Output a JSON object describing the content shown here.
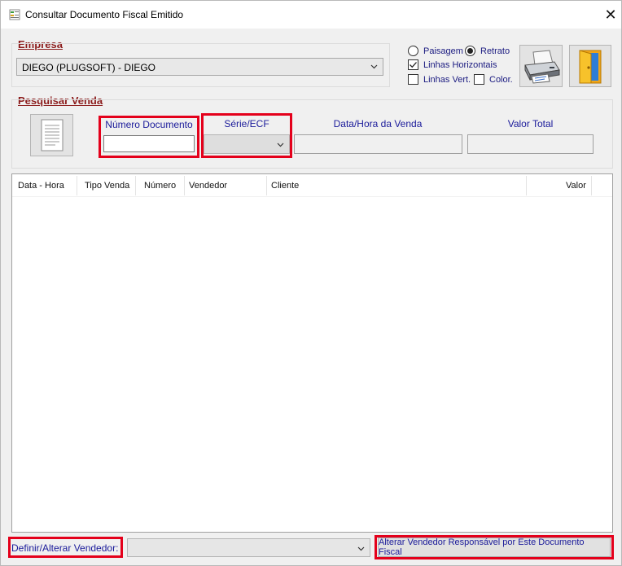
{
  "window": {
    "title": "Consultar Documento Fiscal Emitido",
    "close_glyph": "✕"
  },
  "empresa": {
    "section_title": "Empresa",
    "selected": "DIEGO  (PLUGSOFT) - DIEGO"
  },
  "print_options": {
    "paisagem": "Paisagem",
    "retrato": "Retrato",
    "linhas_horizontais": "Linhas Horizontais",
    "linhas_vert": "Linhas Vert.",
    "color": "Color.",
    "selected_orientation": "Retrato",
    "linhas_horizontais_checked": true,
    "linhas_vert_checked": false,
    "color_checked": false
  },
  "icons": {
    "printer": "printer-icon",
    "exit": "exit-door-icon",
    "document": "document-icon"
  },
  "pesquisar": {
    "section_title": "Pesquisar Venda",
    "numero_documento_label": "Número Documento",
    "numero_documento_value": "",
    "serie_ecf_label": "Série/ECF",
    "serie_ecf_value": "",
    "data_hora_label": "Data/Hora da Venda",
    "data_hora_value": "",
    "valor_total_label": "Valor Total",
    "valor_total_value": ""
  },
  "table": {
    "columns": [
      "Data - Hora",
      "Tipo Venda",
      "Número",
      "Vendedor",
      "Cliente",
      "Valor"
    ],
    "rows": []
  },
  "footer": {
    "vendedor_label": "Definir/Alterar Vendedor:",
    "vendedor_value": "",
    "alterar_button": "Alterar Vendedor Responsável por Este Documento Fiscal"
  },
  "colors": {
    "highlight_frame": "#e4001b",
    "section_title": "#8b1a1a",
    "label_blue": "#1a1a9a"
  }
}
